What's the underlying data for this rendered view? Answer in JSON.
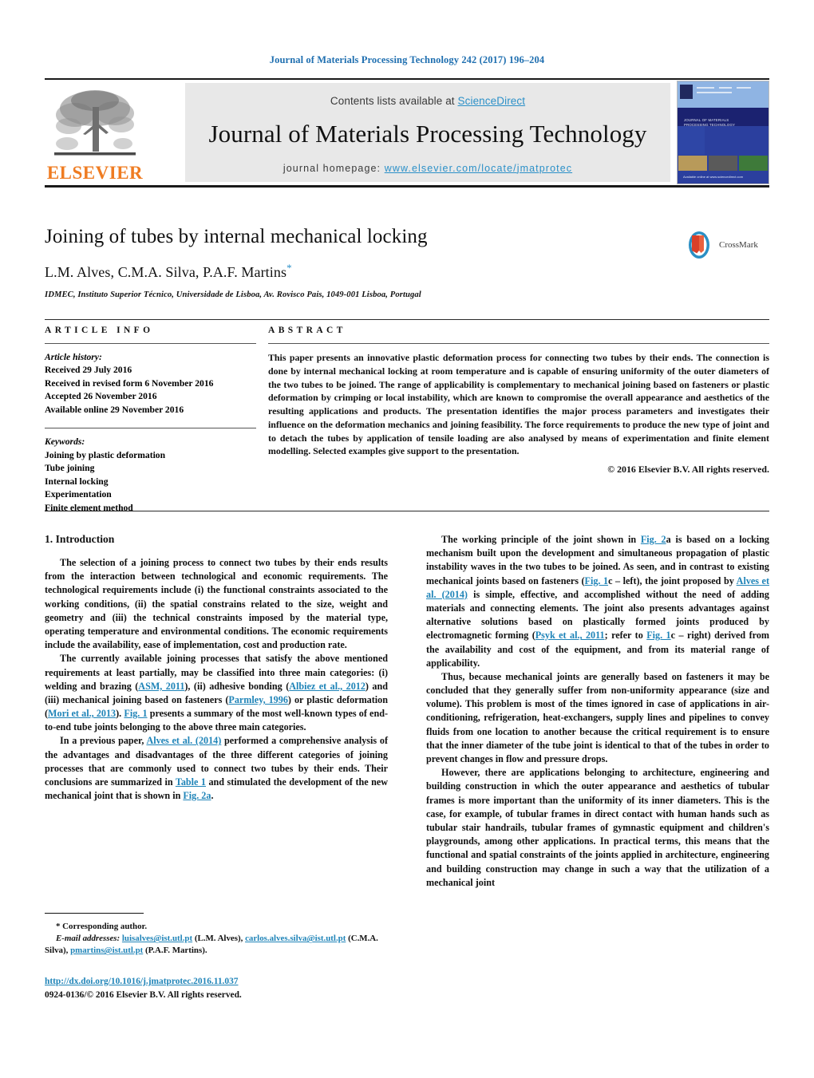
{
  "colors": {
    "link": "#1f84b8",
    "running_head": "#1f6fb0",
    "elsevier_orange": "#ef7c22",
    "banner_bg": "#e8e8e8",
    "sciencedirect_blue": "#2b90c8"
  },
  "running_head": "Journal of Materials Processing Technology 242 (2017) 196–204",
  "masthead": {
    "publisher_wordmark": "ELSEVIER",
    "contents_prefix": "Contents lists available at ",
    "contents_link": "ScienceDirect",
    "journal_title": "Journal of Materials Processing Technology",
    "homepage_prefix": "journal homepage: ",
    "homepage_url": "www.elsevier.com/locate/jmatprotec",
    "cover": {
      "band_title_line1": "JOURNAL OF MATERIALS",
      "band_title_line2": "PROCESSING TECHNOLOGY",
      "footer_line1": "ELSEVIER",
      "footer_line2": "Available online at www.sciencedirect.com"
    }
  },
  "title_block": {
    "title": "Joining of tubes by internal mechanical locking",
    "authors": "L.M. Alves, C.M.A. Silva, P.A.F. Martins",
    "corresponding_marker": "*",
    "affiliation": "IDMEC, Instituto Superior Técnico, Universidade de Lisboa, Av. Rovisco Pais, 1049-001 Lisboa, Portugal",
    "crossmark_label": "CrossMark"
  },
  "article_info": {
    "heading": "ARTICLE INFO",
    "history_label": "Article history:",
    "history": [
      "Received 29 July 2016",
      "Received in revised form 6 November 2016",
      "Accepted 26 November 2016",
      "Available online 29 November 2016"
    ],
    "keywords_label": "Keywords:",
    "keywords": [
      "Joining by plastic deformation",
      "Tube joining",
      "Internal locking",
      "Experimentation",
      "Finite element method"
    ]
  },
  "abstract": {
    "heading": "ABSTRACT",
    "text": "This paper presents an innovative plastic deformation process for connecting two tubes by their ends. The connection is done by internal mechanical locking at room temperature and is capable of ensuring uniformity of the outer diameters of the two tubes to be joined. The range of applicability is complementary to mechanical joining based on fasteners or plastic deformation by crimping or local instability, which are known to compromise the overall appearance and aesthetics of the resulting applications and products. The presentation identifies the major process parameters and investigates their influence on the deformation mechanics and joining feasibility. The force requirements to produce the new type of joint and to detach the tubes by application of tensile loading are also analysed by means of experimentation and finite element modelling. Selected examples give support to the presentation.",
    "copyright": "© 2016 Elsevier B.V. All rights reserved."
  },
  "body": {
    "section_number_title": "1.  Introduction",
    "left_paragraphs": [
      "The selection of a joining process to connect two tubes by their ends results from the interaction between technological and economic requirements. The technological requirements include (i) the functional constraints associated to the working conditions, (ii) the spatial constrains related to the size, weight and geometry and (iii) the technical constraints imposed by the material type, operating temperature and environmental conditions. The economic requirements include the availability, ease of implementation, cost and production rate."
    ],
    "left_p2": {
      "a": "The currently available joining processes that satisfy the above mentioned requirements at least partially, may be classified into three main categories: (i) welding and brazing (",
      "r1": "ASM, 2011",
      "b": "), (ii) adhesive bonding (",
      "r2": "Albiez et al., 2012",
      "c": ") and (iii) mechanical joining based on fasteners (",
      "r3": "Parmley, 1996",
      "d": ") or plastic deformation (",
      "r4": "Mori et al., 2013",
      "e": "). ",
      "r5": "Fig. 1",
      "f": " presents a summary of the most well-known types of end-to-end tube joints belonging to the above three main categories."
    },
    "left_p3": {
      "a": "In a previous paper, ",
      "r1": "Alves et al. (2014)",
      "b": " performed a comprehensive analysis of the advantages and disadvantages of the three different categories of joining processes that are commonly used to connect two tubes by their ends. Their conclusions are summarized in ",
      "r2": "Table 1",
      "c": " and stimulated the development of the new mechanical joint that is shown in ",
      "r3": "Fig. 2a",
      "d": "."
    },
    "right_p1": {
      "a": "The working principle of the joint shown in ",
      "r1": "Fig. 2",
      "b": "a is based on a locking mechanism built upon the development and simultaneous propagation of plastic instability waves in the two tubes to be joined. As seen, and in contrast to existing mechanical joints based on fasteners (",
      "r2": "Fig. 1",
      "c": "c – left), the joint proposed by ",
      "r3": "Alves et al. (2014)",
      "d": " is simple, effective, and accomplished without the need of adding materials and connecting elements. The joint also presents advantages against alternative solutions based on plastically formed joints produced by electromagnetic forming (",
      "r4": "Psyk et al., 2011",
      "e": "; refer to ",
      "r5": "Fig. 1",
      "f": "c – right) derived from the availability and cost of the equipment, and from its material range of applicability."
    },
    "right_p2": "Thus, because mechanical joints are generally based on fasteners it may be concluded that they generally suffer from non-uniformity appearance (size and volume). This problem is most of the times ignored in case of applications in air-conditioning, refrigeration, heat-exchangers, supply lines and pipelines to convey fluids from one location to another because the critical requirement is to ensure that the inner diameter of the tube joint is identical to that of the tubes in order to prevent changes in flow and pressure drops.",
    "right_p3": "However, there are applications belonging to architecture, engineering and building construction in which the outer appearance and aesthetics of tubular frames is more important than the uniformity of its inner diameters. This is the case, for example, of tubular frames in direct contact with human hands such as tubular stair handrails, tubular frames of gymnastic equipment and children's playgrounds, among other applications. In practical terms, this means that the functional and spatial constraints of the joints applied in architecture, engineering and building construction may change in such a way that the utilization of a mechanical joint"
  },
  "footnotes": {
    "corresponding": "*  Corresponding author.",
    "email_label": "E-mail addresses:",
    "email1": "luisalves@ist.utl.pt",
    "email1_owner": " (L.M. Alves), ",
    "email2": "carlos.alves.silva@ist.utl.pt",
    "email2_owner": " (C.M.A. Silva), ",
    "email3": "pmartins@ist.utl.pt",
    "email3_owner": " (P.A.F. Martins)."
  },
  "doi": {
    "url": "http://dx.doi.org/10.1016/j.jmatprotec.2016.11.037",
    "issn": "0924-0136/© 2016 Elsevier B.V. All rights reserved."
  }
}
